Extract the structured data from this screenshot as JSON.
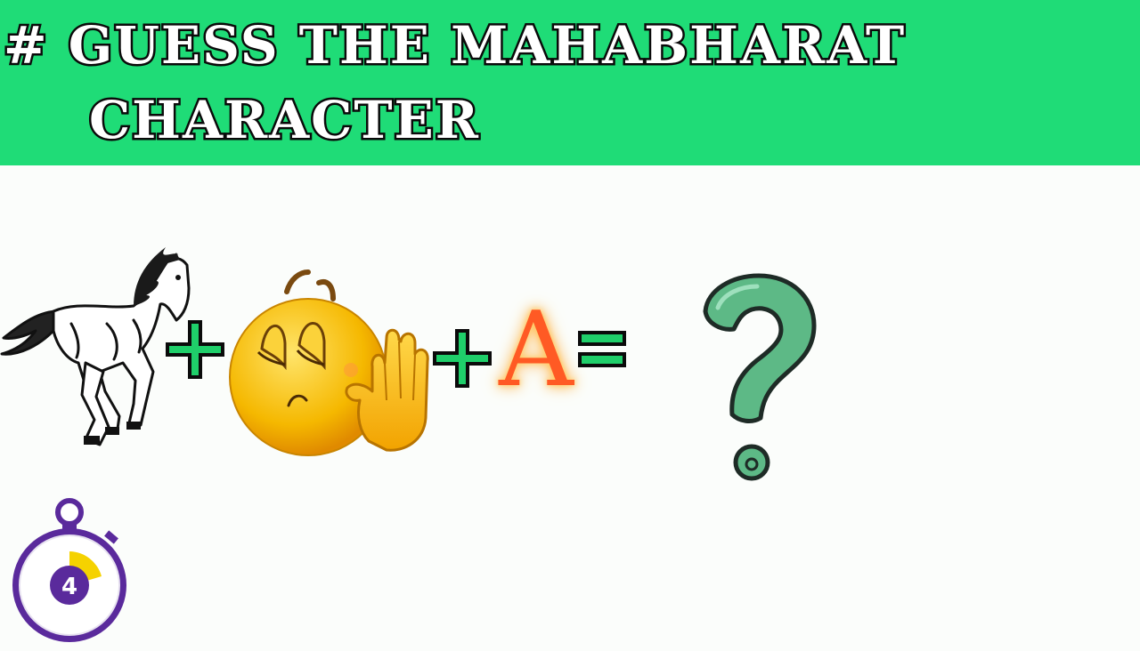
{
  "header": {
    "title_line1": "# GUESS THE MAHABHARAT",
    "title_line2": "CHARACTER",
    "background_color": "#1fdc77"
  },
  "puzzle": {
    "clues": [
      "horse-image",
      "plus-sign",
      "sleepy-hand-stop-emoji",
      "plus-sign",
      "letter-a",
      "equals-sign"
    ],
    "letter": "A",
    "letter_color": "#ff5a24",
    "operator_color": "#1fcf6a",
    "answer_icon": "question-mark-icon",
    "answer_color": "#5db986"
  },
  "timer": {
    "value": "4",
    "ring_color": "#5a2a9c",
    "progress_color": "#f5d200"
  }
}
